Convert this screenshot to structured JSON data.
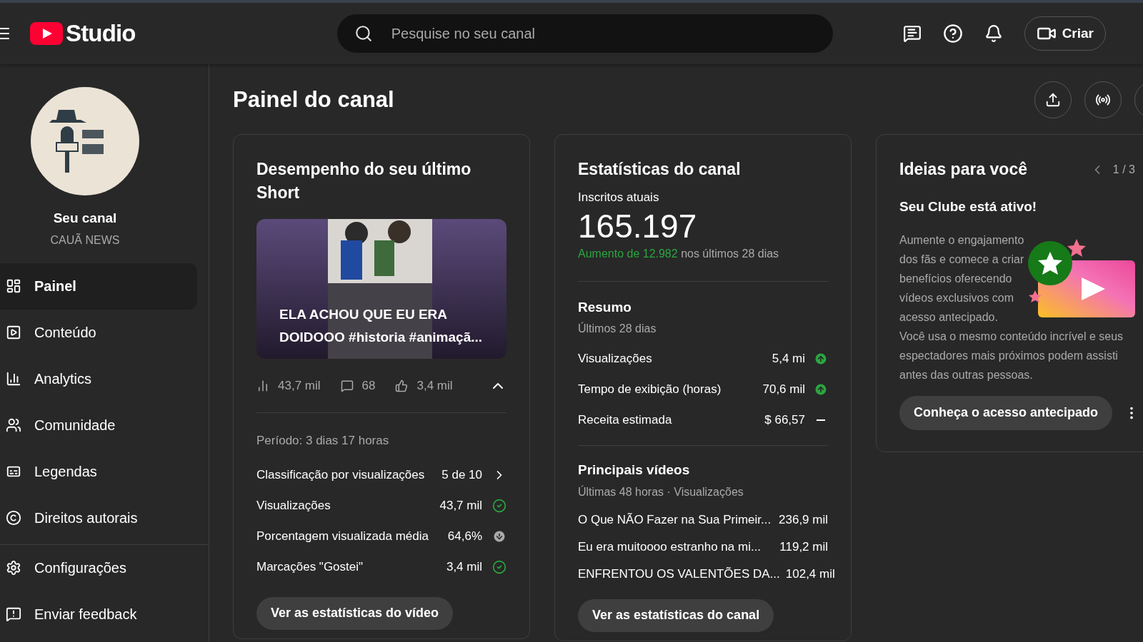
{
  "header": {
    "logo_text": "Studio",
    "search": {
      "placeholder": "Pesquise no seu canal"
    },
    "create_label": "Criar"
  },
  "sidebar": {
    "channel_label": "Seu canal",
    "channel_name": "CAUÃ NEWS",
    "items": [
      {
        "label": "Painel",
        "selected": true
      },
      {
        "label": "Conteúdo",
        "selected": false
      },
      {
        "label": "Analytics",
        "selected": false
      },
      {
        "label": "Comunidade",
        "selected": false
      },
      {
        "label": "Legendas",
        "selected": false
      },
      {
        "label": "Direitos autorais",
        "selected": false
      }
    ],
    "footer_items": [
      {
        "label": "Configurações"
      },
      {
        "label": "Enviar feedback"
      }
    ]
  },
  "page_title": "Painel do canal",
  "short_card": {
    "title": "Desempenho do seu último Short",
    "video_title": "ELA ACHOU QUE EU ERA DOIDOOO #historia #animaçã...",
    "views": "43,7 mil",
    "comments": "68",
    "likes": "3,4 mil",
    "period": "Período: 3 dias 17 horas",
    "metrics": [
      {
        "label": "Classificação por visualizações",
        "value": "5 de 10",
        "kind": "rank"
      },
      {
        "label": "Visualizações",
        "value": "43,7 mil",
        "kind": "good"
      },
      {
        "label": "Porcentagem visualizada média",
        "value": "64,6%",
        "kind": "below"
      },
      {
        "label": "Marcações \"Gostei\"",
        "value": "3,4 mil",
        "kind": "good"
      }
    ],
    "button": "Ver as estatísticas do vídeo"
  },
  "stats_card": {
    "title": "Estatísticas do canal",
    "subscribers_label": "Inscritos atuais",
    "subscribers": "165.197",
    "growth": "Aumento de 12.982",
    "growth_suffix": "nos últimos 28 dias",
    "summary_title": "Resumo",
    "summary_period": "Últimos 28 dias",
    "summary": [
      {
        "label": "Visualizações",
        "value": "5,4 mi",
        "kind": "up"
      },
      {
        "label": "Tempo de exibição (horas)",
        "value": "70,6 mil",
        "kind": "up"
      },
      {
        "label": "Receita estimada",
        "value": "$ 66,57",
        "kind": "flat"
      }
    ],
    "top_title": "Principais vídeos",
    "top_period": "Últimas 48 horas · Visualizações",
    "top_videos": [
      {
        "title": "O Que NÃO Fazer na Sua Primeir...",
        "views": "236,9 mil"
      },
      {
        "title": "Eu era muitoooo estranho na mi...",
        "views": "119,2 mil"
      },
      {
        "title": "ENFRENTOU OS VALENTÕES DA...",
        "views": "102,4 mil"
      }
    ],
    "button": "Ver as estatísticas do canal"
  },
  "ideas_card": {
    "title": "Ideias para você",
    "pager": "1 / 3",
    "subtitle": "Seu Clube está ativo!",
    "text": "Aumente o engajamento dos fãs e comece a criar benefícios oferecendo vídeos exclusivos com acesso antecipado.",
    "text_2": "Você usa o mesmo conteúdo incrível e seus espectadores mais próximos podem assisti antes das outras pessoas.",
    "button": "Conheça o acesso antecipado"
  }
}
